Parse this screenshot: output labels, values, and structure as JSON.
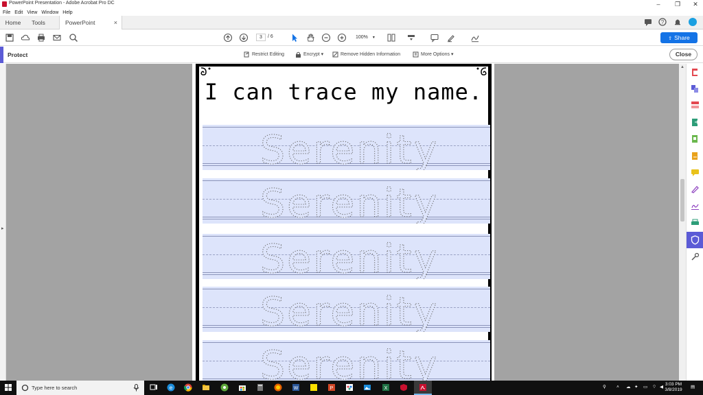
{
  "window": {
    "title": "PowerPoint Presentation - Adobe Acrobat Pro DC",
    "controls": {
      "minimize": "–",
      "restore": "❐",
      "close": "✕"
    }
  },
  "menu": [
    "File",
    "Edit",
    "View",
    "Window",
    "Help"
  ],
  "tabs": {
    "home": "Home",
    "tools": "Tools",
    "document": "PowerPoint Present...",
    "close": "×"
  },
  "toolbar": {
    "current_page": "3",
    "total_pages": "/ 6",
    "zoom": "100%",
    "share_label": "Share"
  },
  "protect": {
    "label": "Protect",
    "restrict_editing": "Restrict Editing",
    "encrypt": "Encrypt ▾",
    "remove_hidden": "Remove Hidden Information",
    "more_options": "More Options ▾",
    "close_label": "Close"
  },
  "worksheet": {
    "heading": "I can trace my name.",
    "trace_word": "Serenity"
  },
  "taskbar": {
    "search_placeholder": "Type here to search",
    "time": "3:03 PM",
    "date": "3/8/2019"
  },
  "colors": {
    "accent": "#5b5bd6",
    "share": "#1473e6",
    "trace_band": "#dde4fb"
  }
}
